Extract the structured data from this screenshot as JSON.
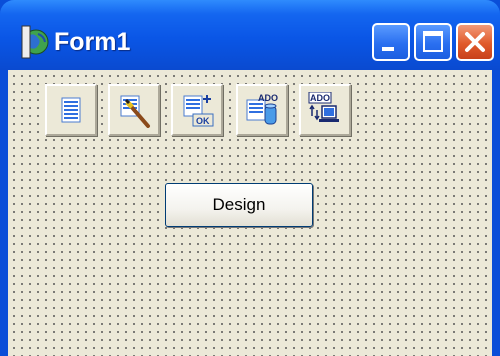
{
  "window": {
    "title": "Form1",
    "controls": {
      "minimize": "minimize-icon",
      "maximize": "maximize-icon",
      "close": "close-icon"
    }
  },
  "form": {
    "components": [
      {
        "name": "list-component-icon"
      },
      {
        "name": "picture-brush-icon"
      },
      {
        "name": "add-record-ok-icon"
      },
      {
        "name": "ado-database-icon",
        "text": "ADO"
      },
      {
        "name": "ado-connection-icon",
        "text": "ADO"
      }
    ],
    "design_button_label": "Design"
  },
  "colors": {
    "titlebar": "#0a56e6",
    "form_background": "#ece9d8",
    "close_button": "#e05a2b"
  }
}
